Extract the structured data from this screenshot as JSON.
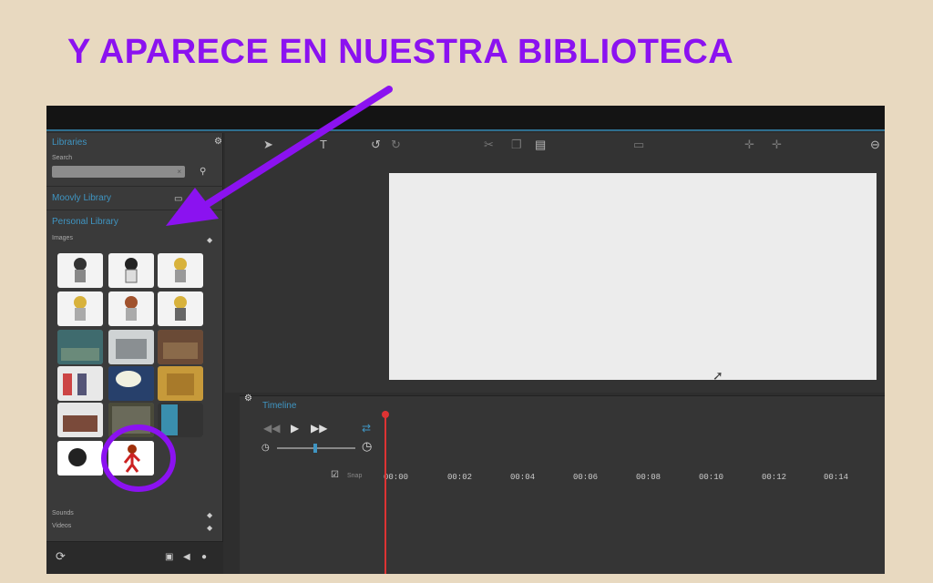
{
  "slide": {
    "title": "Y APARECE EN NUESTRA BIBLIOTECA",
    "title_color": "#8b12f0"
  },
  "sidebar": {
    "libraries_label": "Libraries",
    "search_label": "Search",
    "search_value": "",
    "search_clear": "×",
    "moovly_library_label": "Moovly Library",
    "personal_library_label": "Personal Library",
    "images_label": "Images",
    "sounds_label": "Sounds",
    "videos_label": "Videos",
    "thumbnails": [
      {
        "kind": "character"
      },
      {
        "kind": "character"
      },
      {
        "kind": "character"
      },
      {
        "kind": "character"
      },
      {
        "kind": "character"
      },
      {
        "kind": "character"
      },
      {
        "kind": "scene"
      },
      {
        "kind": "scene"
      },
      {
        "kind": "scene"
      },
      {
        "kind": "scene"
      },
      {
        "kind": "scene"
      },
      {
        "kind": "scene"
      },
      {
        "kind": "scene"
      },
      {
        "kind": "scene"
      },
      {
        "kind": "scene"
      },
      {
        "kind": "character"
      },
      {
        "kind": "character",
        "highlighted": true
      }
    ]
  },
  "toolbar": {
    "text_tool": "T"
  },
  "timeline": {
    "title": "Timeline",
    "snap_label": "Snap",
    "ticks": [
      "00:00",
      "00:02",
      "00:04",
      "00:06",
      "00:08",
      "00:10",
      "00:12",
      "00:14"
    ]
  },
  "colors": {
    "accent_blue": "#3f95c2",
    "playhead": "#dd3333",
    "annotation": "#8b12f0"
  }
}
